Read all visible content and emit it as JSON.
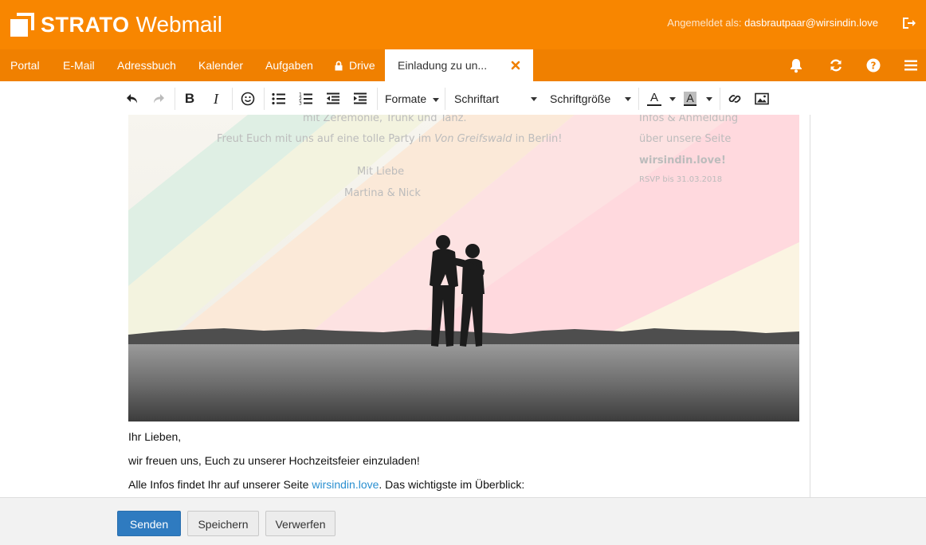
{
  "brand": {
    "name": "STRATO",
    "product": "Webmail",
    "color": "#f88600"
  },
  "account": {
    "label": "Angemeldet als:",
    "email": "dasbrautpaar@wirsindin.love"
  },
  "nav": {
    "items": [
      "Portal",
      "E-Mail",
      "Adressbuch",
      "Kalender",
      "Aufgaben",
      "Drive"
    ],
    "active_tab": "Einladung zu un..."
  },
  "toolbar": {
    "formats": "Formate",
    "font": "Schriftart",
    "font_size": "Schriftgröße",
    "text_color_glyph": "A",
    "bg_color_glyph": "A"
  },
  "invitation": {
    "line1": "mit Zeremonie, Trunk und Tanz.",
    "line2_pre": "Freut Euch mit uns auf eine tolle Party im",
    "line2_venue": "Von Greifswald",
    "line2_post": "in Berlin!",
    "closing": "Mit Liebe",
    "names": "Martina & Nick",
    "info1": "Infos & Anmeldung",
    "info2": "über unsere Seite",
    "site": "wirsindin.love!",
    "rsvp": "RSVP bis 31.03.2018"
  },
  "message": {
    "greeting": "Ihr Lieben,",
    "line1": "wir freuen uns, Euch zu unserer Hochzeitsfeier einzuladen!",
    "line2_pre": "Alle Infos findet Ihr auf unserer Seite",
    "line2_link": "wirsindin.love",
    "line2_post": ". Das wichtigste im Überblick:"
  },
  "footer": {
    "send": "Senden",
    "save": "Speichern",
    "discard": "Verwerfen"
  }
}
